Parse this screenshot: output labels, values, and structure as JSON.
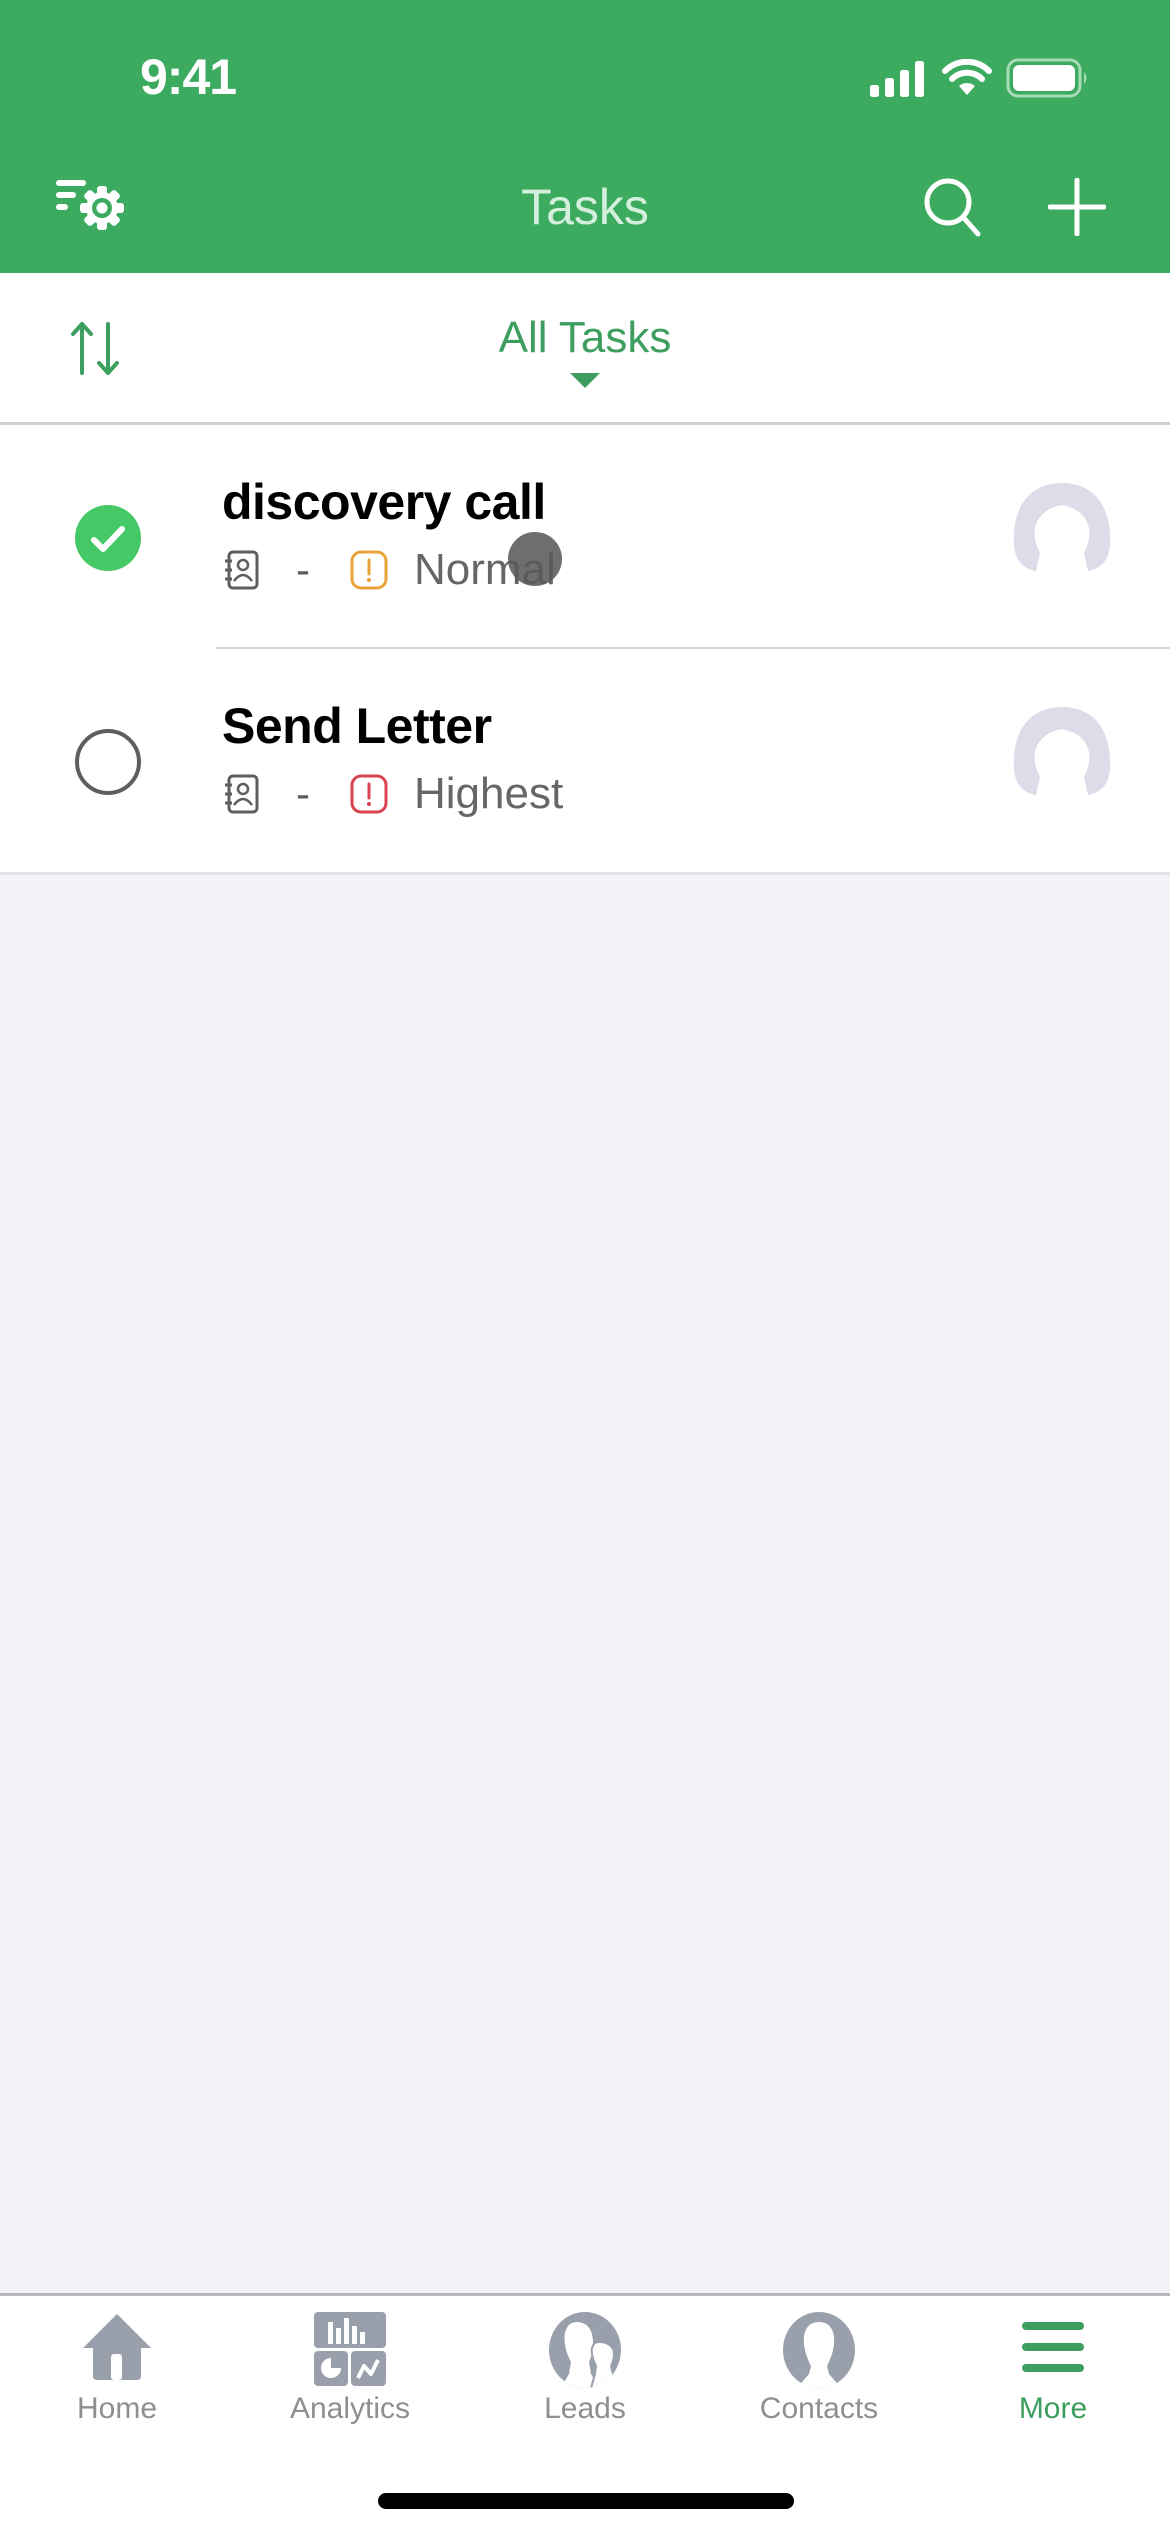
{
  "status_bar": {
    "time": "9:41",
    "icons": [
      "cellular-signal-icon",
      "wifi-icon",
      "battery-icon"
    ]
  },
  "nav": {
    "title": "Tasks",
    "left_icon": "filter-settings-icon",
    "right_icons": [
      "search-icon",
      "add-icon"
    ]
  },
  "filter_bar": {
    "sort_icon": "sort-arrows-icon",
    "view_label": "All Tasks",
    "dropdown_icon": "caret-down-icon"
  },
  "tasks": [
    {
      "title": "discovery call",
      "completed": true,
      "contact": "-",
      "priority": "Normal",
      "priority_color": "#e8a33a"
    },
    {
      "title": "Send Letter",
      "completed": false,
      "contact": "-",
      "priority": "Highest",
      "priority_color": "#d9434f"
    }
  ],
  "tab_bar": {
    "items": [
      {
        "label": "Home",
        "icon": "home-icon",
        "active": false
      },
      {
        "label": "Analytics",
        "icon": "analytics-icon",
        "active": false
      },
      {
        "label": "Leads",
        "icon": "leads-icon",
        "active": false
      },
      {
        "label": "Contacts",
        "icon": "contacts-icon",
        "active": false
      },
      {
        "label": "More",
        "icon": "menu-icon",
        "active": true
      }
    ]
  },
  "colors": {
    "brand_green": "#3dab5f",
    "accent_green": "#3e9e5f",
    "check_green": "#44c966",
    "inactive_gray": "#8e8e93",
    "background": "#f2f2f7"
  }
}
